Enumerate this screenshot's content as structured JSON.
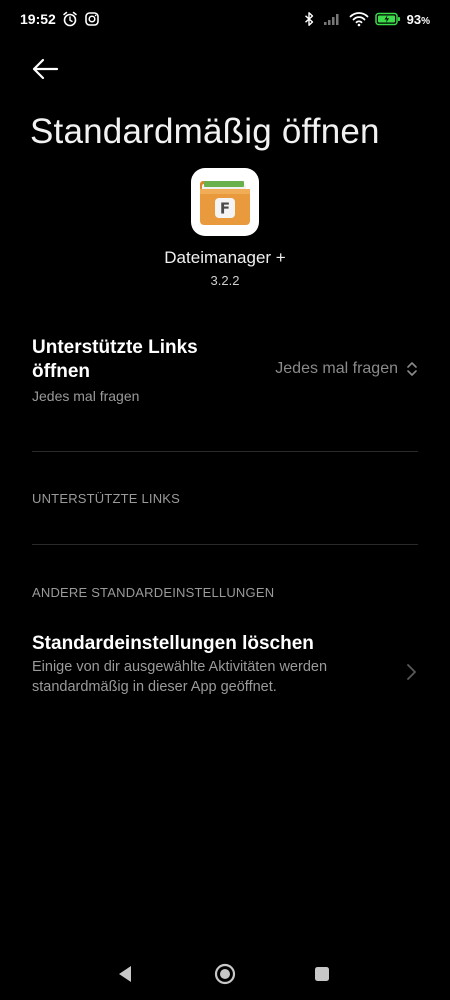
{
  "status_bar": {
    "time": "19:52",
    "battery": "93",
    "battery_unit": "%"
  },
  "header": {
    "title": "Standardmäßig öffnen"
  },
  "app": {
    "name": "Dateimanager +",
    "version": "3.2.2",
    "icon_letter": "F"
  },
  "supported_links_setting": {
    "title": "Unterstützte Links öffnen",
    "subtitle": "Jedes mal fragen",
    "value": "Jedes mal fragen"
  },
  "sections": {
    "supported_links": "UNTERSTÜTZTE LINKS",
    "other_defaults": "ANDERE STANDARDEINSTELLUNGEN"
  },
  "clear_defaults": {
    "title": "Standardeinstellungen löschen",
    "subtitle": "Einige von dir ausgewählte Aktivitäten werden standardmäßig in dieser App geöffnet."
  },
  "colors": {
    "background": "#000000",
    "text_primary": "#ffffff",
    "text_secondary": "#9a9a9a",
    "battery_green": "#3ddc4a",
    "icon_orange": "#e89a3c"
  }
}
